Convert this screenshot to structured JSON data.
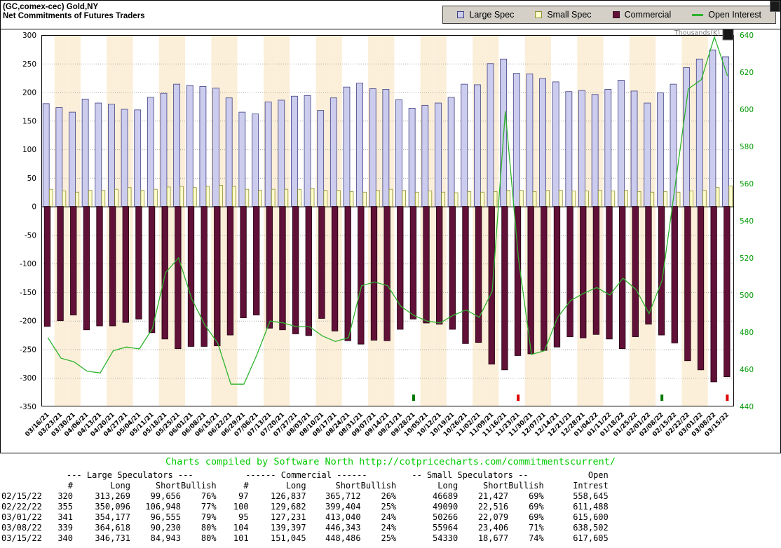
{
  "header": {
    "title_line1": "(GC,comex-cec) Gold,NY",
    "title_line2": "Net Commitments of Futures Traders",
    "legend": [
      {
        "label": "Large Spec",
        "swatch": "square",
        "fill": "#ccccee",
        "border": "#404080"
      },
      {
        "label": "Small Spec",
        "swatch": "square",
        "fill": "#ffffcc",
        "border": "#8f8f30"
      },
      {
        "label": "Commercial",
        "swatch": "square",
        "fill": "#611038",
        "border": "#400824"
      },
      {
        "label": "Open Interest",
        "swatch": "line",
        "fill": "#2db32d",
        "border": ""
      }
    ]
  },
  "chart_data": {
    "type": "bar",
    "title": "Net Commitments of Futures Traders",
    "units": "thousands of contracts (net)",
    "right_axis_label": "Thousands(K)",
    "left_ylim": [
      -350,
      300
    ],
    "right_ylim": [
      440,
      640
    ],
    "left_ticks": [
      300,
      250,
      200,
      150,
      100,
      50,
      0,
      -50,
      -100,
      -150,
      -200,
      -250,
      -300,
      -350
    ],
    "right_ticks": [
      640,
      620,
      600,
      580,
      560,
      540,
      520,
      500,
      480,
      460,
      440
    ],
    "grid": "horizontal-dotted",
    "legend_position": "top-right",
    "categories": [
      "03/16/21",
      "03/23/21",
      "03/30/21",
      "04/06/21",
      "04/13/21",
      "04/20/21",
      "04/27/21",
      "05/04/21",
      "05/11/21",
      "05/18/21",
      "05/25/21",
      "06/01/21",
      "06/08/21",
      "06/15/21",
      "06/22/21",
      "06/29/21",
      "07/06/21",
      "07/13/21",
      "07/20/21",
      "07/27/21",
      "08/03/21",
      "08/10/21",
      "08/17/21",
      "08/24/21",
      "08/31/21",
      "09/07/21",
      "09/14/21",
      "09/21/21",
      "09/28/21",
      "10/05/21",
      "10/12/21",
      "10/19/21",
      "10/26/21",
      "11/02/21",
      "11/09/21",
      "11/16/21",
      "11/23/21",
      "11/30/21",
      "12/07/21",
      "12/14/21",
      "12/21/21",
      "12/28/21",
      "01/04/22",
      "01/11/22",
      "01/18/22",
      "01/25/22",
      "02/01/22",
      "02/08/22",
      "02/15/22",
      "02/22/22",
      "03/01/22",
      "03/08/22",
      "03/15/22"
    ],
    "series": [
      {
        "name": "Large Spec",
        "type": "bar",
        "axis": "left",
        "values": [
          180,
          173,
          165,
          188,
          181,
          179,
          170,
          169,
          191,
          198,
          214,
          212,
          210,
          207,
          190,
          165,
          162,
          183,
          186,
          193,
          194,
          168,
          190,
          209,
          216,
          206,
          205,
          187,
          172,
          177,
          181,
          191,
          214,
          213,
          250,
          258,
          233,
          232,
          224,
          218,
          201,
          203,
          196,
          205,
          221,
          202,
          181,
          199,
          214,
          243,
          258,
          274,
          262
        ]
      },
      {
        "name": "Small Spec",
        "type": "bar",
        "axis": "left",
        "values": [
          30,
          27,
          25,
          28,
          28,
          30,
          33,
          28,
          30,
          34,
          35,
          33,
          35,
          37,
          35,
          30,
          28,
          30,
          30,
          30,
          32,
          28,
          28,
          26,
          25,
          28,
          30,
          28,
          25,
          27,
          25,
          24,
          26,
          25,
          26,
          28,
          28,
          26,
          28,
          28,
          27,
          27,
          28,
          27,
          28,
          26,
          25,
          26,
          25,
          27,
          28,
          33,
          36
        ]
      },
      {
        "name": "Commercial",
        "type": "bar",
        "axis": "left",
        "values": [
          -210,
          -200,
          -190,
          -216,
          -209,
          -209,
          -203,
          -197,
          -221,
          -232,
          -249,
          -245,
          -245,
          -244,
          -225,
          -195,
          -190,
          -213,
          -216,
          -223,
          -226,
          -196,
          -218,
          -235,
          -241,
          -234,
          -235,
          -215,
          -197,
          -204,
          -206,
          -215,
          -240,
          -238,
          -276,
          -286,
          -261,
          -258,
          -252,
          -246,
          -228,
          -230,
          -224,
          -232,
          -249,
          -228,
          -206,
          -225,
          -239,
          -270,
          -286,
          -307,
          -298
        ]
      },
      {
        "name": "Open Interest",
        "type": "line",
        "axis": "right",
        "values": [
          477,
          466,
          464,
          459,
          458,
          470,
          472,
          471,
          482,
          512,
          520,
          498,
          484,
          474,
          452,
          452,
          468,
          486,
          485,
          483,
          483,
          478,
          475,
          477,
          505,
          507,
          505,
          494,
          489,
          486,
          485,
          489,
          492,
          488,
          502,
          599,
          520,
          468,
          470,
          488,
          497,
          501,
          504,
          500,
          509,
          503,
          490,
          508,
          559,
          611,
          616,
          639,
          618
        ]
      }
    ],
    "signals": [
      {
        "date": "09/28/21",
        "color": "green"
      },
      {
        "date": "11/23/21",
        "color": "red"
      },
      {
        "date": "02/08/22",
        "color": "green"
      },
      {
        "date": "03/15/22",
        "color": "red"
      }
    ],
    "colors": {
      "large_spec_fill": "#ccccee",
      "large_spec_border": "#404080",
      "small_spec_fill": "#ffffcc",
      "small_spec_border": "#8f8f30",
      "commercial_fill": "#611038",
      "commercial_border": "#20000e",
      "open_interest": "#2db32d",
      "stripe": "#fcefd9",
      "right_axis_text": "#009900",
      "signal_green": "#007a00",
      "signal_red": "#dd0000"
    }
  },
  "credit": "Charts compiled by Software North  http://cotpricecharts.com/commitmentscurrent/",
  "table": {
    "groups": [
      {
        "label": "--- Large Speculators ---",
        "span": 4
      },
      {
        "label": "------ Commercial ------",
        "span": 4
      },
      {
        "label": "-- Small Speculators --",
        "span": 3
      },
      {
        "label": "Open",
        "span": 1
      }
    ],
    "columns": [
      "",
      "#",
      "Long",
      "Short",
      "Bullish",
      "#",
      "Long",
      "Short",
      "Bullish",
      "Long",
      "Short",
      "Bullish",
      "Intrest"
    ],
    "rows": [
      [
        "02/15/22",
        "320",
        "313,269",
        "99,656",
        "76%",
        "97",
        "126,837",
        "365,712",
        "26%",
        "46689",
        "21,427",
        "69%",
        "558,645"
      ],
      [
        "02/22/22",
        "355",
        "350,096",
        "106,948",
        "77%",
        "100",
        "129,682",
        "399,404",
        "25%",
        "49090",
        "22,516",
        "69%",
        "611,488"
      ],
      [
        "03/01/22",
        "341",
        "354,177",
        "96,555",
        "79%",
        "95",
        "127,231",
        "413,040",
        "24%",
        "50266",
        "22,079",
        "69%",
        "615,600"
      ],
      [
        "03/08/22",
        "339",
        "364,618",
        "90,230",
        "80%",
        "104",
        "139,397",
        "446,343",
        "24%",
        "55964",
        "23,406",
        "71%",
        "638,502"
      ],
      [
        "03/15/22",
        "340",
        "346,731",
        "84,943",
        "80%",
        "101",
        "151,045",
        "448,486",
        "25%",
        "54330",
        "18,677",
        "74%",
        "617,605"
      ]
    ]
  }
}
